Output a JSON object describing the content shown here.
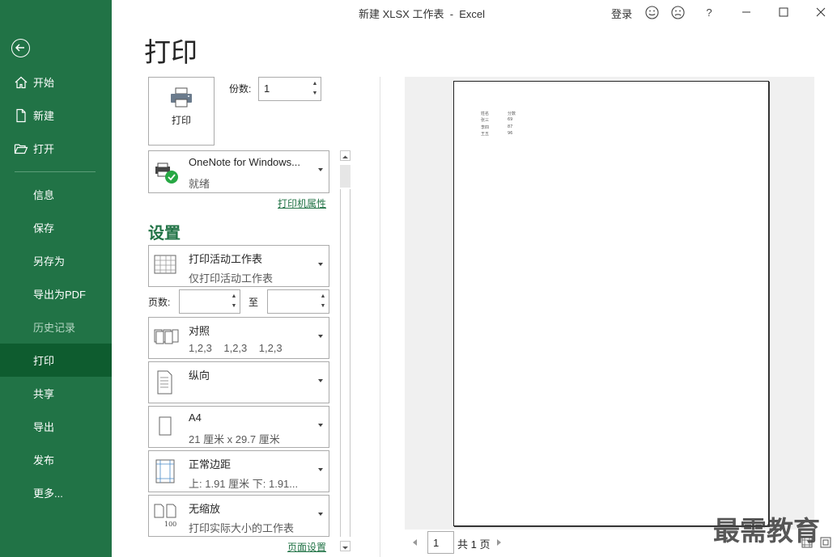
{
  "window": {
    "title": "新建 XLSX 工作表  -  Excel",
    "login": "登录",
    "help": "?"
  },
  "sidebar": {
    "items": [
      {
        "label": "开始",
        "icon": "home-icon"
      },
      {
        "label": "新建",
        "icon": "new-file-icon"
      },
      {
        "label": "打开",
        "icon": "open-folder-icon"
      },
      {
        "label": "信息"
      },
      {
        "label": "保存"
      },
      {
        "label": "另存为"
      },
      {
        "label": "导出为PDF"
      },
      {
        "label": "历史记录"
      },
      {
        "label": "打印"
      },
      {
        "label": "共享"
      },
      {
        "label": "导出"
      },
      {
        "label": "发布"
      },
      {
        "label": "更多..."
      }
    ],
    "active": "打印",
    "accent": "#217346"
  },
  "print": {
    "page_title": "打印",
    "print_button": "打印",
    "copies_label": "份数:",
    "copies_value": "1",
    "printer_name": "OneNote for Windows...",
    "printer_status": "就绪",
    "printer_properties": "打印机属性",
    "settings_heading": "设置",
    "print_what_title": "打印活动工作表",
    "print_what_sub": "仅打印活动工作表",
    "pages_label": "页数:",
    "to_label": "至",
    "collate_title": "对照",
    "collate_sub": "1,2,3    1,2,3    1,2,3",
    "orientation": "纵向",
    "paper_title": "A4",
    "paper_sub": "21 厘米 x 29.7 厘米",
    "margins_title": "正常边距",
    "margins_sub": "上: 1.91 厘米 下: 1.91...",
    "scaling_title": "无缩放",
    "scaling_sub": "打印实际大小的工作表",
    "page_setup": "页面设置",
    "scaling_icon_text": "100"
  },
  "preview": {
    "rows": [
      [
        "姓名",
        "分数"
      ],
      [
        "张三",
        "69"
      ],
      [
        "李四",
        "87"
      ],
      [
        "王五",
        "96"
      ]
    ],
    "current_page": "1",
    "total_pages": "共 1 页"
  },
  "watermark": "最需教育"
}
